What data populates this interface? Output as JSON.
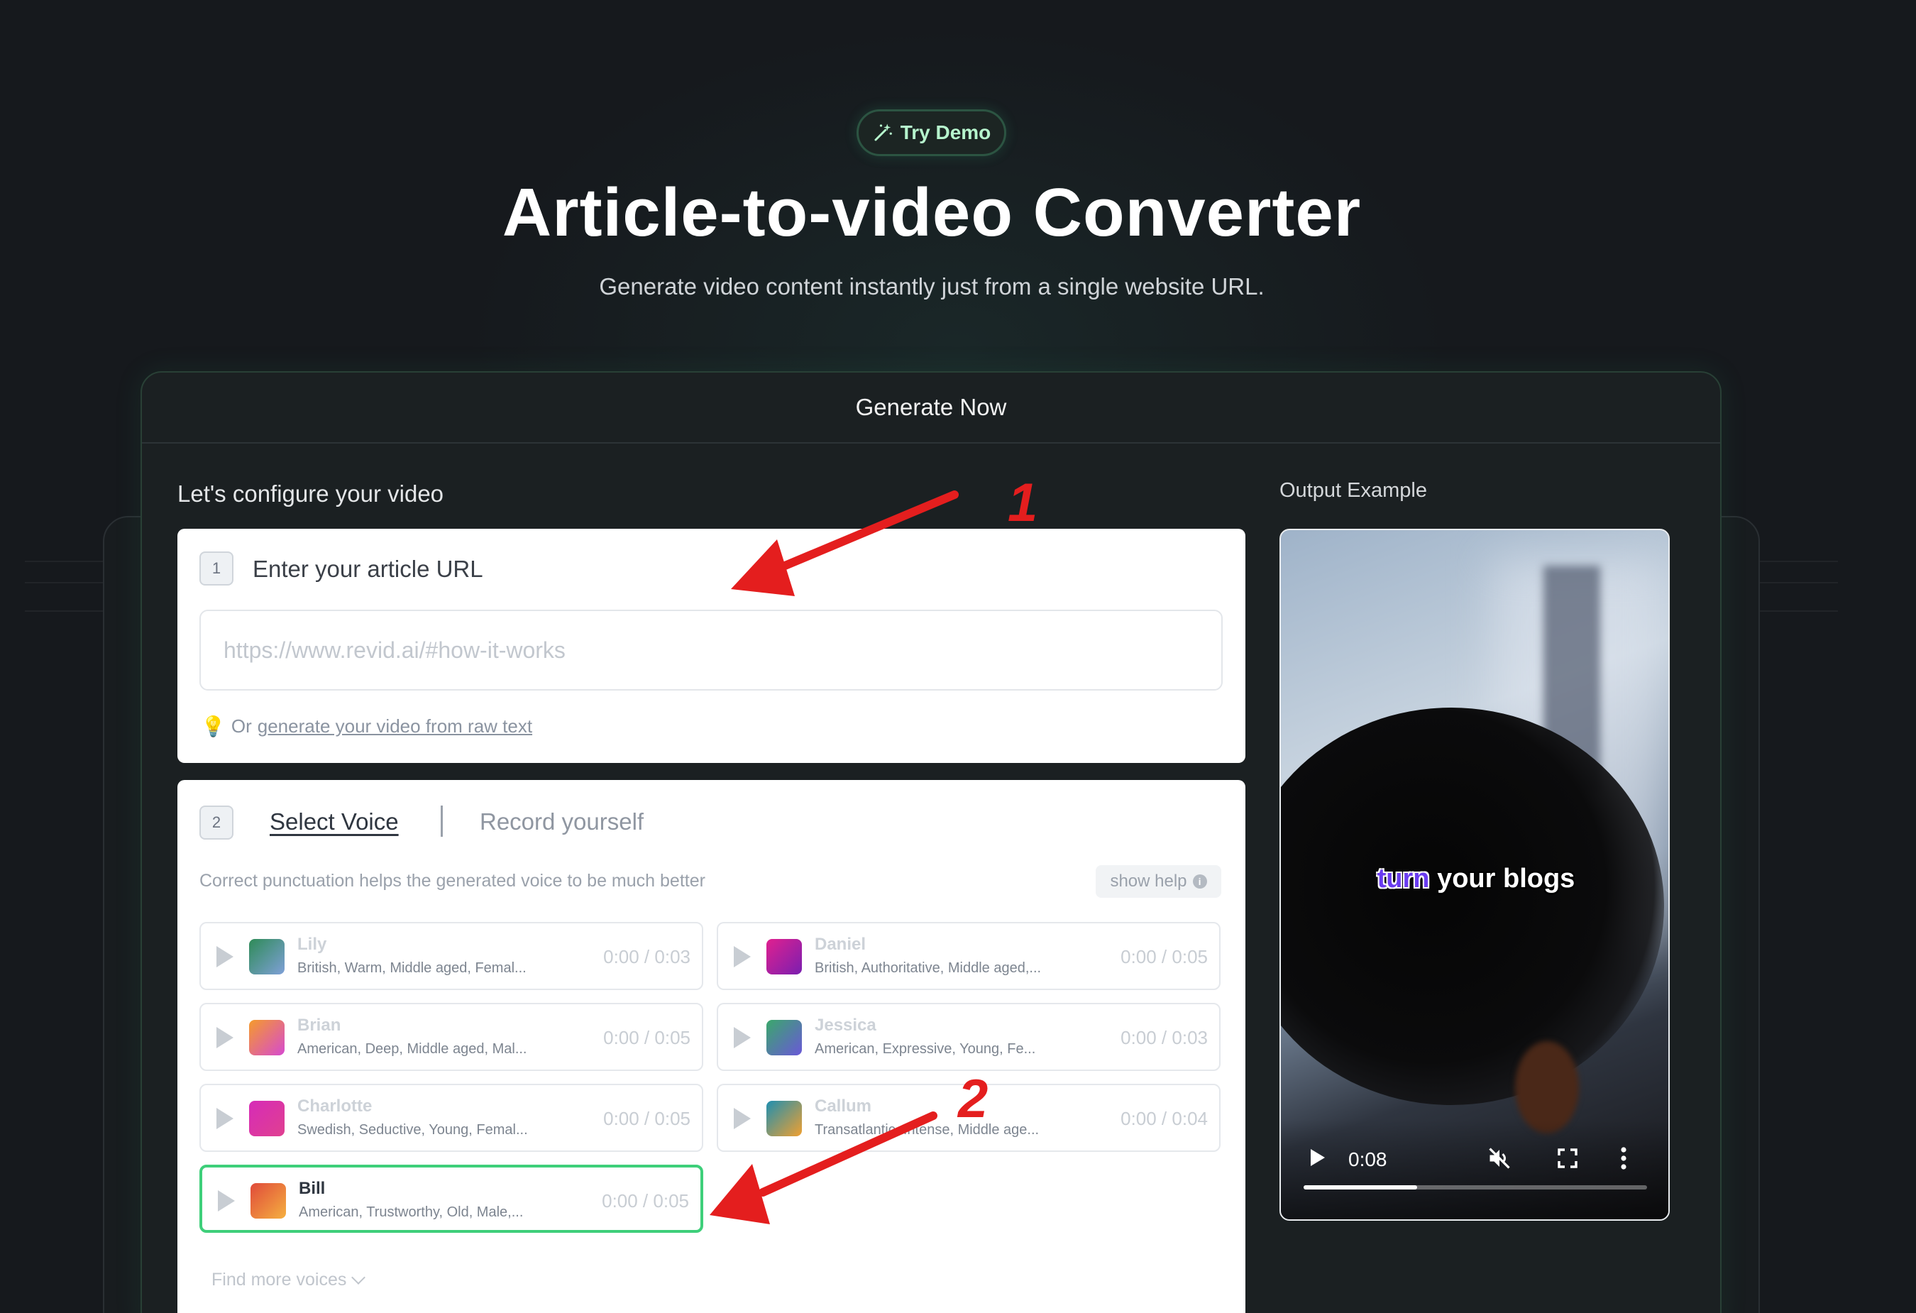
{
  "demo_badge": {
    "label": "Try Demo",
    "icon": "magic-wand-icon"
  },
  "hero": {
    "title": "Article-to-video Converter",
    "subtitle": "Generate video content instantly just from a single website URL."
  },
  "card": {
    "header": "Generate Now",
    "config_label": "Let's configure your video",
    "output_label": "Output Example"
  },
  "step1": {
    "number": "1",
    "title": "Enter your article URL",
    "url_placeholder": "https://www.revid.ai/#how-it-works",
    "url_value": "",
    "hint_prefix": "Or",
    "hint_link": "generate your video from raw text",
    "hint_icon": "lightbulb-icon"
  },
  "step2": {
    "number": "2",
    "tab_select": "Select Voice",
    "tab_record": "Record yourself",
    "help_text": "Correct punctuation helps the generated voice to be much better",
    "show_help": "show help",
    "find_more": "Find more voices",
    "voices": [
      {
        "name": "Lily",
        "desc": "British, Warm, Middle aged, Femal...",
        "time": "0:00 / 0:03",
        "gradient": [
          "#2e8b57",
          "#7fa0d8"
        ]
      },
      {
        "name": "Daniel",
        "desc": "British, Authoritative, Middle aged,...",
        "time": "0:00 / 0:05",
        "gradient": [
          "#e0208f",
          "#7a1fb0"
        ]
      },
      {
        "name": "Brian",
        "desc": "American, Deep, Middle aged, Mal...",
        "time": "0:00 / 0:05",
        "gradient": [
          "#f59b2b",
          "#d64ad0"
        ]
      },
      {
        "name": "Jessica",
        "desc": "American, Expressive, Young, Fe...",
        "time": "0:00 / 0:03",
        "gradient": [
          "#3aa86b",
          "#6a58d8"
        ]
      },
      {
        "name": "Charlotte",
        "desc": "Swedish, Seductive, Young, Femal...",
        "time": "0:00 / 0:05",
        "gradient": [
          "#d62bb8",
          "#e04090"
        ]
      },
      {
        "name": "Callum",
        "desc": "Transatlantic, Intense, Middle age...",
        "time": "0:00 / 0:04",
        "gradient": [
          "#1f8fb0",
          "#f0a030"
        ]
      },
      {
        "name": "Bill",
        "desc": "American, Trustworthy, Old, Male,...",
        "time": "0:00 / 0:05",
        "gradient": [
          "#e04a3a",
          "#f5b040"
        ]
      }
    ],
    "selected_voice": "Bill"
  },
  "video": {
    "caption_highlight": "turn",
    "caption_rest": " your blogs",
    "current_time": "0:08",
    "progress_fraction": 0.33
  },
  "annotations": {
    "marker1": "1",
    "marker2": "2",
    "color": "#e41e1e"
  },
  "colors": {
    "background": "#16191d",
    "accent_green": "#3ecf7a",
    "demo_text": "#b6f5cd"
  }
}
